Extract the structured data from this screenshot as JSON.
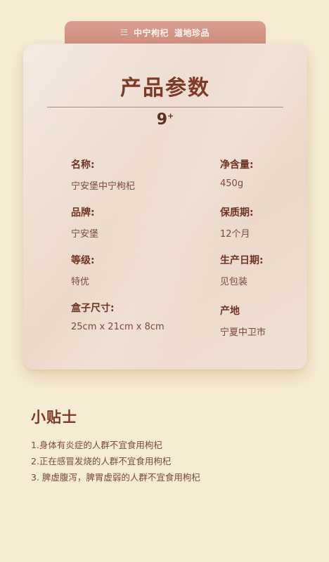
{
  "header": {
    "brand": "中宁枸杞",
    "slogan": "道地珍品"
  },
  "card": {
    "title": "产品参数",
    "badge_number": "9",
    "badge_sup": "+"
  },
  "specs": {
    "left": [
      {
        "label": "名称:",
        "value": "宁安堡中宁枸杞"
      },
      {
        "label": "品牌:",
        "value": "宁安堡"
      },
      {
        "label": "等级:",
        "value": "特优"
      },
      {
        "label": "盒子尺寸:",
        "value": "25cm x 21cm x 8cm"
      }
    ],
    "right": [
      {
        "label": "净含量:",
        "value": "450g"
      },
      {
        "label": "保质期:",
        "value": "12个月"
      },
      {
        "label": "生产日期:",
        "value": "见包装"
      },
      {
        "label": "产地",
        "value": "宁夏中卫市"
      }
    ]
  },
  "tips": {
    "title": "小贴士",
    "items": [
      "1.身体有炎症的人群不宜食用枸杞",
      "2.正在感冒发烧的人群不宜食用枸杞",
      "3. 脾虚腹泻，脾胃虚弱的人群不宜食用枸杞"
    ]
  }
}
